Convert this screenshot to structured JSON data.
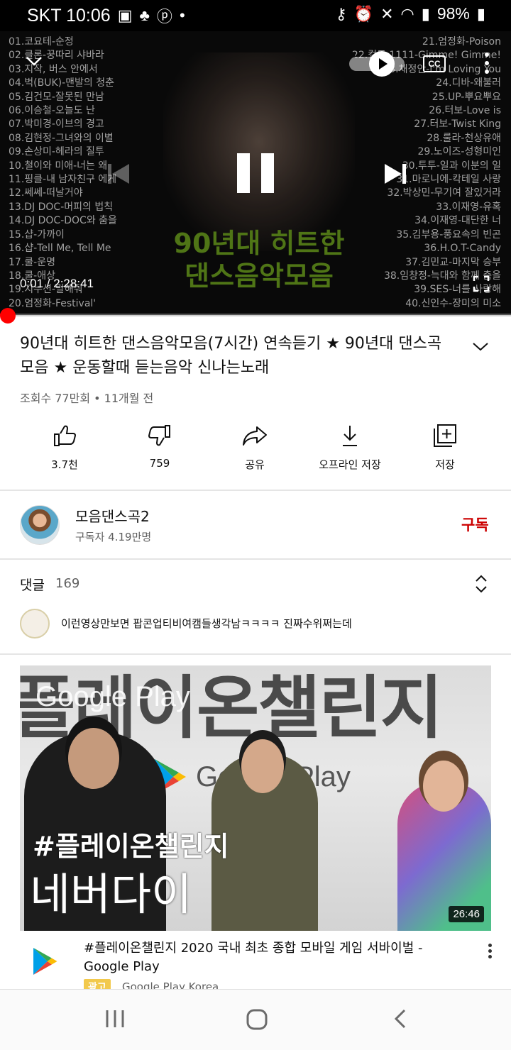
{
  "status_bar": {
    "carrier_time": "SKT 10:06",
    "battery": "98%",
    "left_icons": [
      "gallery-icon",
      "notification-icon",
      "pinterest-icon",
      "dot-icon"
    ],
    "right_icons": [
      "key-icon",
      "alarm-icon",
      "mute-icon",
      "wifi-icon",
      "signal-icon",
      "battery-icon"
    ]
  },
  "player": {
    "tracks_left": [
      "01.코요테-순정",
      "02.클론-꿍따리 샤바라",
      "03.지작, 버스 안에서",
      "04.벅(BUK)-맨발의 청춘",
      "05.김건모-잘못된 만남",
      "06.이승철-오늘도 난",
      "07.박미경-이브의 경고",
      "08.김현정-그녀와의 이별",
      "09.손상미-헤라의 질투",
      "10.철이와 미애-너는 왜",
      "11.핑클-내 남자친구 에게",
      "12.쎄쎄-떠날거야",
      "13.DJ DOC-머피의 법칙",
      "14.DJ DOC-DOC와 춤을",
      "15.샵-가까이",
      "16.샵-Tell Me, Tell Me",
      "17.쿨-운명",
      "18.쿨-애상",
      "19.지누션-말해줘",
      "20.엄정화-Festival'"
    ],
    "tracks_right": [
      "21.엄정화-Poison",
      "22.컬트 1111-Gimme! Gimme!",
      "23.채정안-I'm Loving You",
      "24.디바-왜불러",
      "25.UP-뿌요뿌요",
      "26.터보-Love is",
      "27.터보-Twist King",
      "28.룰라-천상유애",
      "29.노이즈-성형미인",
      "30.투투-일과 이분의 일",
      "31.마로니에-칵테일 사랑",
      "32.박상민-무기여 잘있거라",
      "33.이재영-유혹",
      "34.이재영-대단한 너",
      "35.김부용-풍요속의 빈곤",
      "36.H.O.T-Candy",
      "37.김민교-마지막 승부",
      "38.임창정-늑대와 함께 춤을",
      "39.SES-너를 사랑해",
      "40.신인수-장미의 미소"
    ],
    "hero_title_line1": "90년대 히트한",
    "hero_title_line2": "댄스음악모음",
    "time": "0:01 / 2:28:41",
    "progress_fraction": 0.002
  },
  "video": {
    "title": "90년대 히트한 댄스음악모음(7시간) 연속듣기 ★ 90년대 댄스곡 모음 ★ 운동할때 듣는음악 신나는노래",
    "meta": "조회수 77만회 • 11개월 전"
  },
  "actions": [
    {
      "label": "3.7천",
      "icon": "thumbs-up-icon"
    },
    {
      "label": "759",
      "icon": "thumbs-down-icon"
    },
    {
      "label": "공유",
      "icon": "share-icon"
    },
    {
      "label": "오프라인 저장",
      "icon": "download-icon"
    },
    {
      "label": "저장",
      "icon": "add-to-playlist-icon"
    }
  ],
  "channel": {
    "name": "모음댄스곡2",
    "subscribers": "구독자 4.19만명",
    "subscribe_label": "구독",
    "subscribe_color": "#cc0000"
  },
  "comments": {
    "label": "댓글",
    "count": "169",
    "top_comment": "이런영상만보면 팝콘업티비여캠들생각남ㅋㅋㅋㅋ 진짜수위쩌는데"
  },
  "ad": {
    "thumb_big_text": "플레이온챌린지",
    "thumb_brand": "Google Play",
    "thumb_hashtag": "#플레이온챌린지",
    "thumb_subtitle": "네버다이",
    "duration": "26:46",
    "title": "#플레이온챌린지 2020 국내 최초 종합 모바일 게임 서바이벌 - Google Play",
    "badge": "광고",
    "advertiser": "Google Play Korea"
  },
  "navbar": {
    "buttons": [
      "recent-apps-icon",
      "home-icon",
      "back-icon"
    ]
  }
}
